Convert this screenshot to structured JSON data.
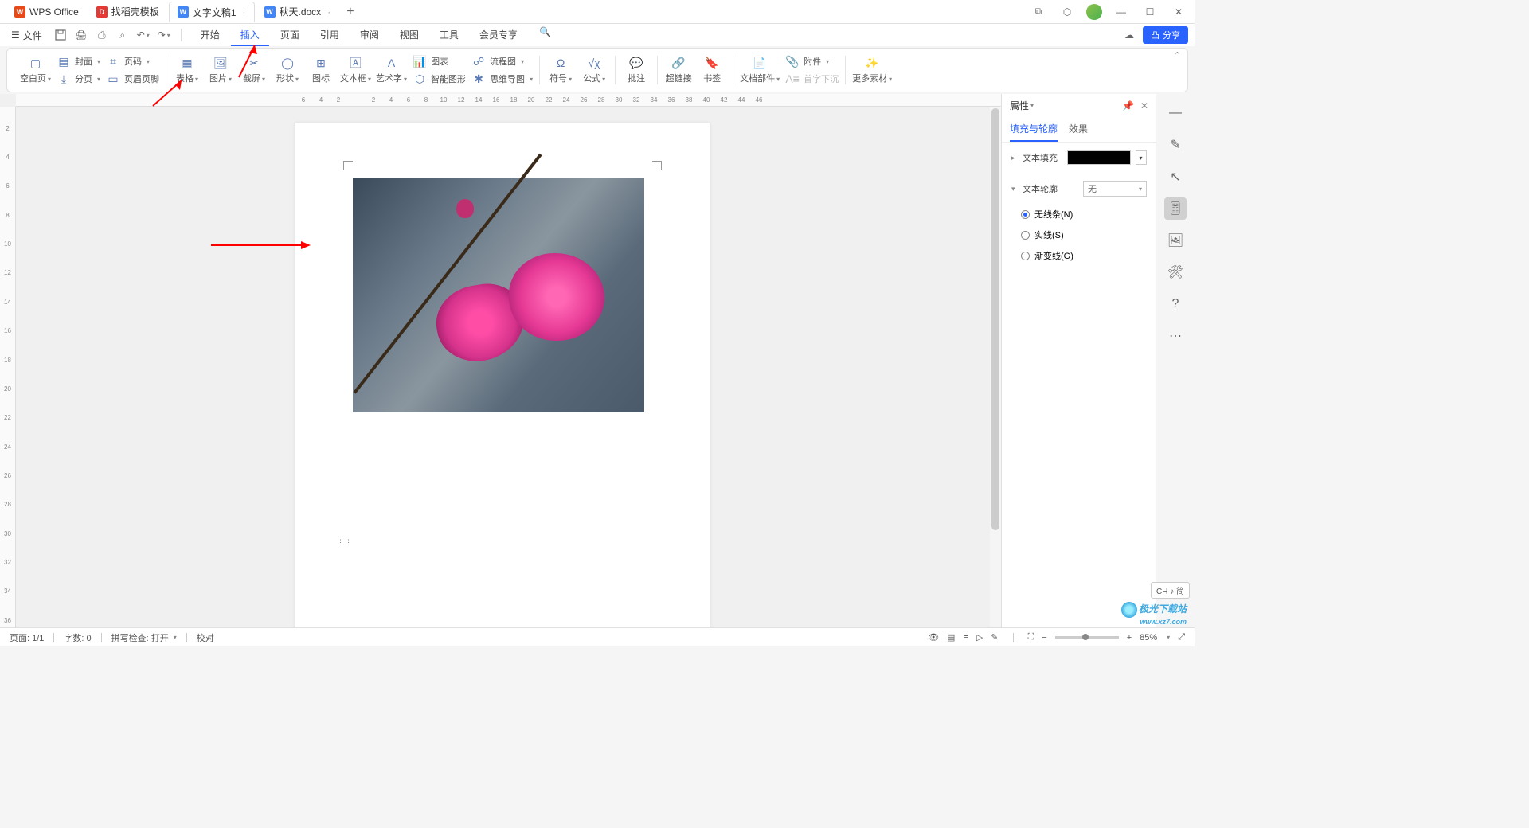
{
  "titlebar": {
    "tabs": [
      {
        "label": "WPS Office",
        "icon": "wps"
      },
      {
        "label": "找稻壳模板",
        "icon": "d"
      },
      {
        "label": "文字文稿1",
        "icon": "w",
        "active": true
      },
      {
        "label": "秋天.docx",
        "icon": "w"
      }
    ],
    "new_tab": "+"
  },
  "menubar": {
    "file": "文件",
    "tabs": [
      "开始",
      "插入",
      "页面",
      "引用",
      "审阅",
      "视图",
      "工具",
      "会员专享"
    ],
    "active_tab": "插入",
    "share": "分享"
  },
  "ribbon": {
    "blank_page": "空白页",
    "cover": "封面",
    "page_break": "分页",
    "page_number": "页码",
    "header_footer": "页眉页脚",
    "table": "表格",
    "picture": "图片",
    "screenshot": "截屏",
    "shape": "形状",
    "icon": "图标",
    "textbox": "文本框",
    "wordart": "艺术字",
    "chart": "图表",
    "smartart": "智能图形",
    "flowchart": "流程图",
    "mindmap": "思维导图",
    "symbol": "符号",
    "equation": "公式",
    "comment": "批注",
    "hyperlink": "超链接",
    "bookmark": "书签",
    "docparts": "文档部件",
    "attachment": "附件",
    "dropcap": "首字下沉",
    "more": "更多素材"
  },
  "ruler_h": [
    "6",
    "4",
    "2",
    "",
    "2",
    "4",
    "6",
    "8",
    "10",
    "12",
    "14",
    "16",
    "18",
    "20",
    "22",
    "24",
    "26",
    "28",
    "30",
    "32",
    "34",
    "36",
    "38",
    "40",
    "42",
    "44",
    "46"
  ],
  "ruler_v": [
    "",
    "2",
    "",
    "4",
    "",
    "6",
    "",
    "8",
    "",
    "10",
    "",
    "12",
    "",
    "14",
    "",
    "16",
    "",
    "18",
    "",
    "20",
    "",
    "22",
    "",
    "24",
    "",
    "26",
    "",
    "28",
    "",
    "30",
    "",
    "32",
    "",
    "34",
    "",
    "36"
  ],
  "panel": {
    "title": "属性",
    "tabs": [
      "填充与轮廓",
      "效果"
    ],
    "active_tab": "填充与轮廓",
    "text_fill": "文本填充",
    "text_outline": "文本轮廓",
    "outline_value": "无",
    "radio_none": "无线条(N)",
    "radio_solid": "实线(S)",
    "radio_gradient": "渐变线(G)"
  },
  "status": {
    "page": "页面: 1/1",
    "words": "字数: 0",
    "spell": "拼写检查: 打开",
    "proof": "校对",
    "zoom": "85%"
  },
  "ime": "CH ♪ 简",
  "watermark": {
    "text": "极光下载站",
    "url": "www.xz7.com"
  }
}
